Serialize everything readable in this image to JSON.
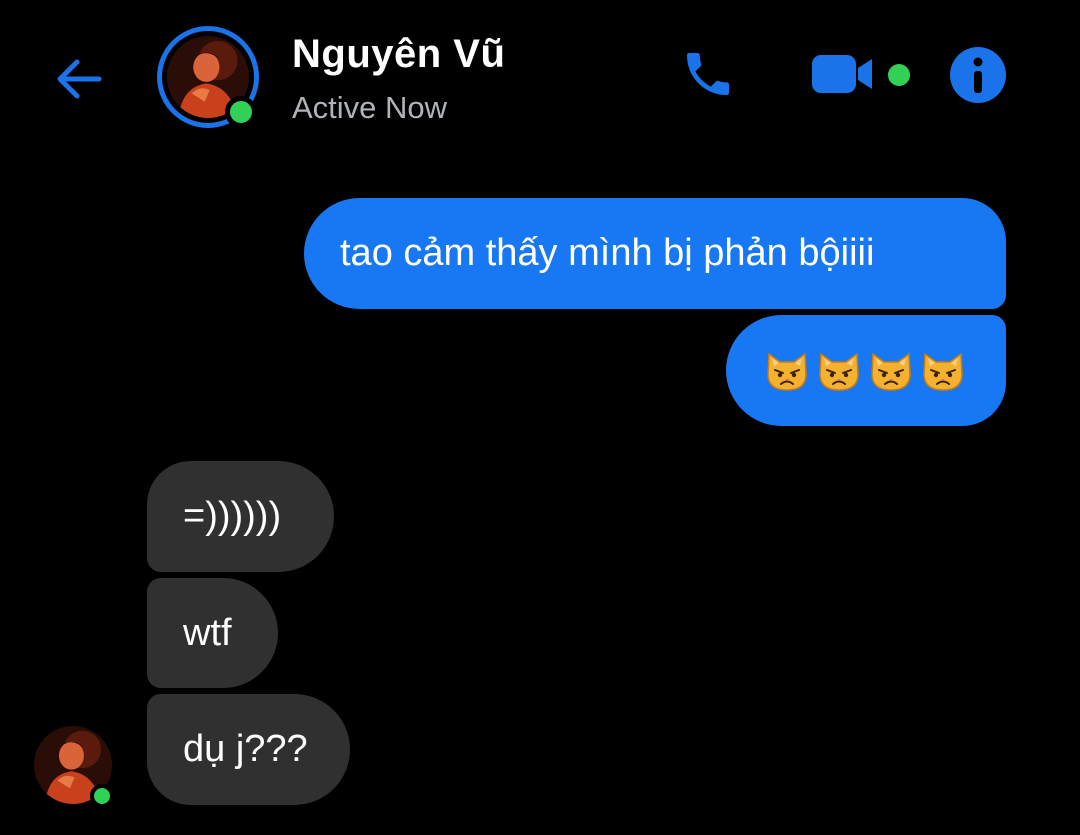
{
  "header": {
    "contact_name": "Nguyên Vũ",
    "status": "Active Now",
    "back_icon": "arrow-left-icon",
    "call_icon": "phone-icon",
    "video_icon": "video-camera-icon",
    "info_icon": "info-icon",
    "accent_color": "#1a73e8",
    "online_color": "#31d158"
  },
  "messages": [
    {
      "direction": "outgoing",
      "text": "tao cảm thấy mình bị phản bộiiii"
    },
    {
      "direction": "outgoing",
      "emoji": [
        "😾",
        "😾",
        "😾",
        "😾"
      ],
      "emoji_name": "pouting-cat-face"
    },
    {
      "direction": "incoming",
      "text": "=))))))"
    },
    {
      "direction": "incoming",
      "text": "wtf"
    },
    {
      "direction": "incoming",
      "text": "dụ j???"
    }
  ],
  "colors": {
    "background": "#000000",
    "outgoing_bubble": "#1877f2",
    "incoming_bubble": "#303030",
    "status_text": "#b0b3b8"
  }
}
